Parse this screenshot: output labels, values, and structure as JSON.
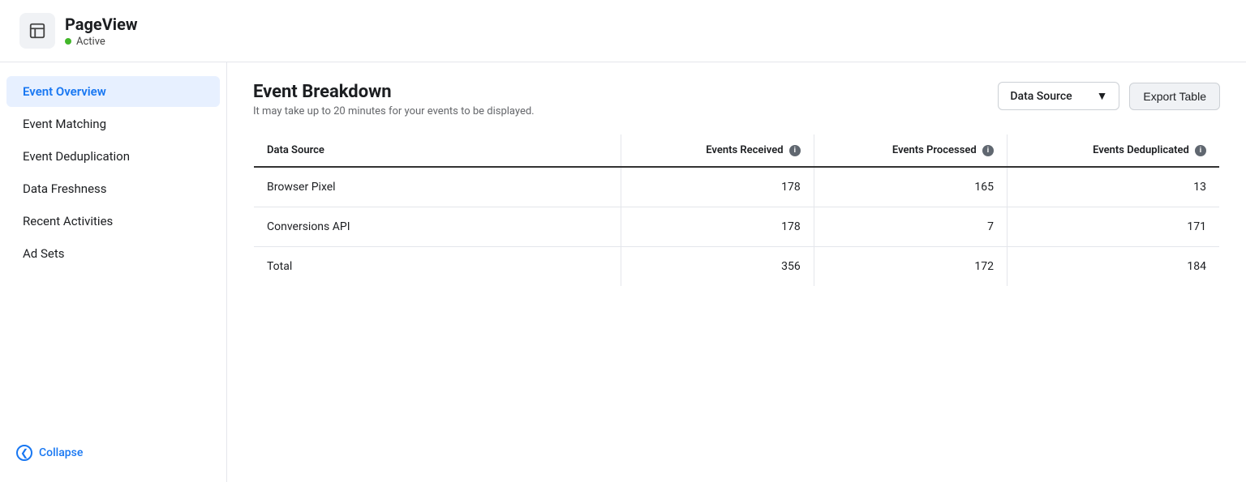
{
  "header": {
    "icon_label": "layout-icon",
    "title": "PageView",
    "status": "Active",
    "status_color": "#42b72a"
  },
  "sidebar": {
    "items": [
      {
        "id": "event-overview",
        "label": "Event Overview",
        "active": true
      },
      {
        "id": "event-matching",
        "label": "Event Matching",
        "active": false
      },
      {
        "id": "event-deduplication",
        "label": "Event Deduplication",
        "active": false
      },
      {
        "id": "data-freshness",
        "label": "Data Freshness",
        "active": false
      },
      {
        "id": "recent-activities",
        "label": "Recent Activities",
        "active": false
      },
      {
        "id": "ad-sets",
        "label": "Ad Sets",
        "active": false
      }
    ],
    "collapse_label": "Collapse"
  },
  "main": {
    "title": "Event Breakdown",
    "subtitle": "It may take up to 20 minutes for your events to be displayed.",
    "data_source_label": "Data Source",
    "export_label": "Export Table",
    "table": {
      "columns": [
        {
          "id": "source",
          "label": "Data Source",
          "has_info": false
        },
        {
          "id": "received",
          "label": "Events Received",
          "has_info": true
        },
        {
          "id": "processed",
          "label": "Events Processed",
          "has_info": true
        },
        {
          "id": "deduplicated",
          "label": "Events Deduplicated",
          "has_info": true
        }
      ],
      "rows": [
        {
          "source": "Browser Pixel",
          "received": "178",
          "processed": "165",
          "deduplicated": "13"
        },
        {
          "source": "Conversions API",
          "received": "178",
          "processed": "7",
          "deduplicated": "171"
        },
        {
          "source": "Total",
          "received": "356",
          "processed": "172",
          "deduplicated": "184"
        }
      ]
    }
  }
}
